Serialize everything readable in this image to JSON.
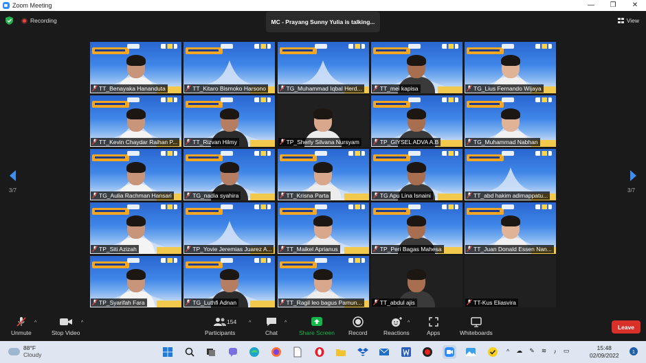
{
  "window": {
    "title": "Zoom Meeting",
    "minimize": "—",
    "maximize": "❐",
    "close": "✕"
  },
  "topbar": {
    "recording_label": "Recording",
    "talking_label": "MC - Prayang Sunny Yulia is talking...",
    "view_label": "View"
  },
  "pager": {
    "left": "3/7",
    "right": "3/7"
  },
  "tiles": [
    {
      "name": "TT_Benayaka Hananduta",
      "bg": true,
      "person": true
    },
    {
      "name": "TT_Kitaro Bismoko Harsono",
      "bg": true,
      "person": false
    },
    {
      "name": "TG_Muhammad Iqbal Herd...",
      "bg": true,
      "person": false
    },
    {
      "name": "TT_mei kapisa",
      "bg": true,
      "person": true
    },
    {
      "name": "TG_Lius Fernando Wijaya",
      "bg": true,
      "person": true
    },
    {
      "name": "TT_Kevin Chaydar Raihan P...",
      "bg": true,
      "person": true
    },
    {
      "name": "TT_Rizvan Hilmy",
      "bg": true,
      "person": true
    },
    {
      "name": "TP_Sherly Silvana Nursyam",
      "bg": false,
      "person": true
    },
    {
      "name": "TP_GIYSEL ADVA A.B",
      "bg": true,
      "person": true
    },
    {
      "name": "TG_Muhammad Nabhan",
      "bg": true,
      "person": true
    },
    {
      "name": "TG_Aulia Rachman Hansari",
      "bg": true,
      "person": true
    },
    {
      "name": "TG_nadia syahira",
      "bg": true,
      "person": true
    },
    {
      "name": "TT_Krisna Parta",
      "bg": true,
      "person": true
    },
    {
      "name": "TG Apu Lina Isnaini",
      "bg": true,
      "person": true
    },
    {
      "name": "TT_abd hakim adimappatu...",
      "bg": true,
      "person": false
    },
    {
      "name": "TP_Siti Azizah",
      "bg": true,
      "person": true
    },
    {
      "name": "TP_Yovie Jeremias Juarez A...",
      "bg": true,
      "person": false
    },
    {
      "name": "TT_Maikel Aprianus",
      "bg": true,
      "person": true
    },
    {
      "name": "TP_Peri Bagas Mahesa",
      "bg": true,
      "person": true
    },
    {
      "name": "TT_Juan Donald Essen Nan...",
      "bg": true,
      "person": true
    },
    {
      "name": "TP_Syarifah Fara",
      "bg": true,
      "person": true
    },
    {
      "name": "TG_Luthfi Adnan",
      "bg": true,
      "person": true
    },
    {
      "name": "TT_Ragil leo bagus Pamun...",
      "bg": true,
      "person": true
    },
    {
      "name": "TT_abdul ajis",
      "bg": false,
      "person": true
    },
    {
      "name": "TT-Kus Eliasvira",
      "bg": false,
      "person": false
    }
  ],
  "toolbar": {
    "unmute": "Unmute",
    "stop_video": "Stop Video",
    "participants": "Participants",
    "participants_count": "154",
    "chat": "Chat",
    "share_screen": "Share Screen",
    "record": "Record",
    "reactions": "Reactions",
    "apps": "Apps",
    "whiteboards": "Whiteboards",
    "leave": "Leave"
  },
  "taskbar": {
    "temperature": "88°F",
    "condition": "Cloudy",
    "time": "15:48",
    "date": "02/09/2022",
    "notifications": "1"
  },
  "colors": {
    "share_green": "#12b84a",
    "leave_red": "#d9312a",
    "tile_blue": "#2f6fd6"
  }
}
